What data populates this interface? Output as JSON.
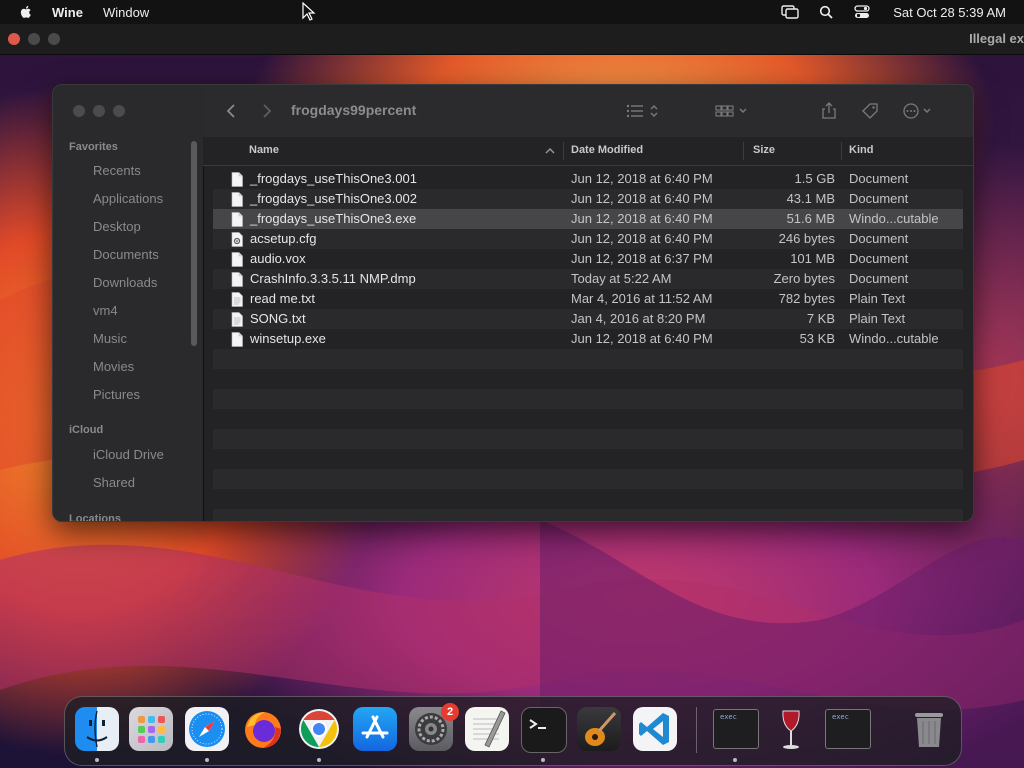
{
  "menubar": {
    "app_name": "Wine",
    "menus": [
      "Window"
    ],
    "datetime": "Sat Oct 28  5:39 AM"
  },
  "wine_window": {
    "title": "Illegal ex"
  },
  "finder": {
    "title": "frogdays99percent",
    "sidebar": {
      "favorites_label": "Favorites",
      "favorites": [
        "Recents",
        "Applications",
        "Desktop",
        "Documents",
        "Downloads",
        "vm4",
        "Music",
        "Movies",
        "Pictures"
      ],
      "icloud_label": "iCloud",
      "icloud": [
        "iCloud Drive",
        "Shared"
      ],
      "locations_label": "Locations"
    },
    "columns": {
      "name": "Name",
      "date": "Date Modified",
      "size": "Size",
      "kind": "Kind"
    },
    "files": [
      {
        "name": "_frogdays_useThisOne3.001",
        "date": "Jun 12, 2018 at 6:40 PM",
        "size": "1.5 GB",
        "kind": "Document",
        "icon": "document-icon"
      },
      {
        "name": "_frogdays_useThisOne3.002",
        "date": "Jun 12, 2018 at 6:40 PM",
        "size": "43.1 MB",
        "kind": "Document",
        "icon": "document-icon"
      },
      {
        "name": "_frogdays_useThisOne3.exe",
        "date": "Jun 12, 2018 at 6:40 PM",
        "size": "51.6 MB",
        "kind": "Windo...cutable",
        "icon": "document-icon",
        "selected": true
      },
      {
        "name": "acsetup.cfg",
        "date": "Jun 12, 2018 at 6:40 PM",
        "size": "246 bytes",
        "kind": "Document",
        "icon": "config-file-icon"
      },
      {
        "name": "audio.vox",
        "date": "Jun 12, 2018 at 6:37 PM",
        "size": "101 MB",
        "kind": "Document",
        "icon": "document-icon"
      },
      {
        "name": "CrashInfo.3.3.5.11 NMP.dmp",
        "date": "Today at 5:22 AM",
        "size": "Zero bytes",
        "kind": "Document",
        "icon": "document-icon"
      },
      {
        "name": "read me.txt",
        "date": "Mar 4, 2016 at 11:52 AM",
        "size": "782 bytes",
        "kind": "Plain Text",
        "icon": "text-file-icon"
      },
      {
        "name": "SONG.txt",
        "date": "Jan 4, 2016 at 8:20 PM",
        "size": "7 KB",
        "kind": "Plain Text",
        "icon": "text-file-icon"
      },
      {
        "name": "winsetup.exe",
        "date": "Jun 12, 2018 at 6:40 PM",
        "size": "53 KB",
        "kind": "Windo...cutable",
        "icon": "document-icon"
      }
    ]
  },
  "dock": {
    "items": [
      "finder-icon",
      "launchpad-icon",
      "safari-icon",
      "firefox-icon",
      "chrome-icon",
      "app-store-icon",
      "system-settings-icon",
      "textedit-icon",
      "terminal-icon",
      "garageband-icon",
      "vscode-icon",
      "exec-window-icon",
      "wine-icon",
      "exec-window-icon",
      "trash-icon"
    ],
    "settings_badge": "2",
    "exec_label": "exec"
  }
}
